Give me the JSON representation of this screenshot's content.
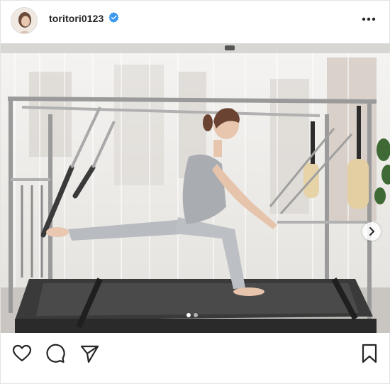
{
  "post": {
    "username": "toritori0123",
    "verified": true,
    "carousel": {
      "current_slide": 1,
      "total_slides": 2
    }
  },
  "icons": {
    "verified": "verified-badge-icon",
    "more": "more-options-icon",
    "like": "heart-icon",
    "comment": "comment-icon",
    "share": "paper-plane-icon",
    "save": "bookmark-icon",
    "next": "chevron-right-icon"
  },
  "colors": {
    "verified_blue": "#3897f0",
    "text": "#262626",
    "border": "#dbdbdb"
  }
}
